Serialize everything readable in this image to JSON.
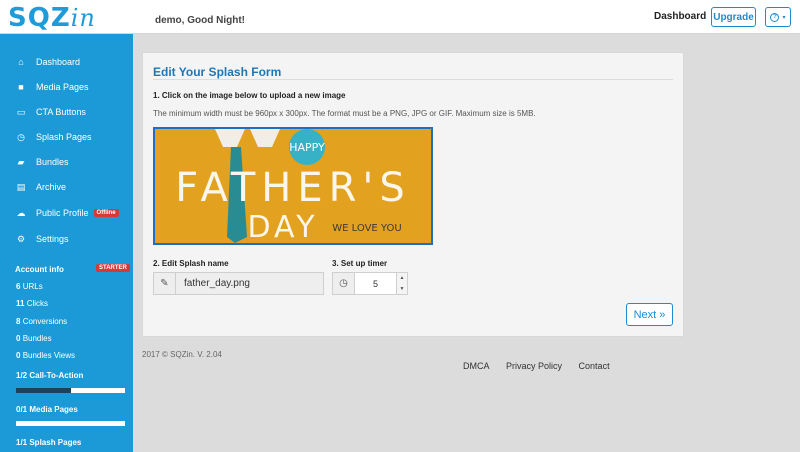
{
  "header": {
    "logo": "SQZ",
    "logo_suffix": "in",
    "greeting": "demo, Good Night!",
    "dashboard_link": "Dashboard",
    "upgrade_label": "Upgrade",
    "help_label": "?"
  },
  "sidebar": {
    "items": [
      {
        "label": "Dashboard",
        "icon": "home-icon"
      },
      {
        "label": "Media Pages",
        "icon": "video-icon"
      },
      {
        "label": "CTA Buttons",
        "icon": "cta-icon"
      },
      {
        "label": "Splash Pages",
        "icon": "clock-icon"
      },
      {
        "label": "Bundles",
        "icon": "folder-icon"
      },
      {
        "label": "Archive",
        "icon": "archive-icon"
      },
      {
        "label": "Public Profile",
        "icon": "cloud-icon",
        "badge": "Offline"
      },
      {
        "label": "Settings",
        "icon": "gear-icon"
      }
    ],
    "account_title": "Account info",
    "account_badge": "STARTER",
    "stats": [
      {
        "value": "6",
        "label": "URLs"
      },
      {
        "value": "11",
        "label": "Clicks"
      },
      {
        "value": "8",
        "label": "Conversions"
      },
      {
        "value": "0",
        "label": "Bundles"
      },
      {
        "value": "0",
        "label": "Bundles Views"
      }
    ],
    "progress": [
      {
        "label": "1/2 Call-To-Action",
        "fraction": 0.5
      },
      {
        "label": "0/1 Media Pages",
        "fraction": 0.0
      },
      {
        "label": "1/1 Splash Pages",
        "fraction": 1.0
      }
    ]
  },
  "form": {
    "title": "Edit Your Splash Form",
    "step1": "1. Click on the image below to upload a new image",
    "hint": "The minimum width must be 960px x 300px. The format must be a PNG, JPG or GIF. Maximum size is 5MB.",
    "image": {
      "happy": "HAPPY",
      "word1": "FATHER'S",
      "word2": "DAY",
      "tagline": "WE LOVE YOU"
    },
    "step2": "2. Edit Splash name",
    "name_value": "father_day.png",
    "step3": "3. Set up timer",
    "timer_value": "5",
    "next_label": "Next »"
  },
  "footer": {
    "copyright": "2017 © SQZin. V. 2.04",
    "links": [
      "DMCA",
      "Privacy Policy",
      "Contact"
    ]
  },
  "colors": {
    "sidebar": "#1b9ad7",
    "accent": "#1e8ad0",
    "badge": "#d33a3a",
    "banner": "#e2a11f"
  }
}
